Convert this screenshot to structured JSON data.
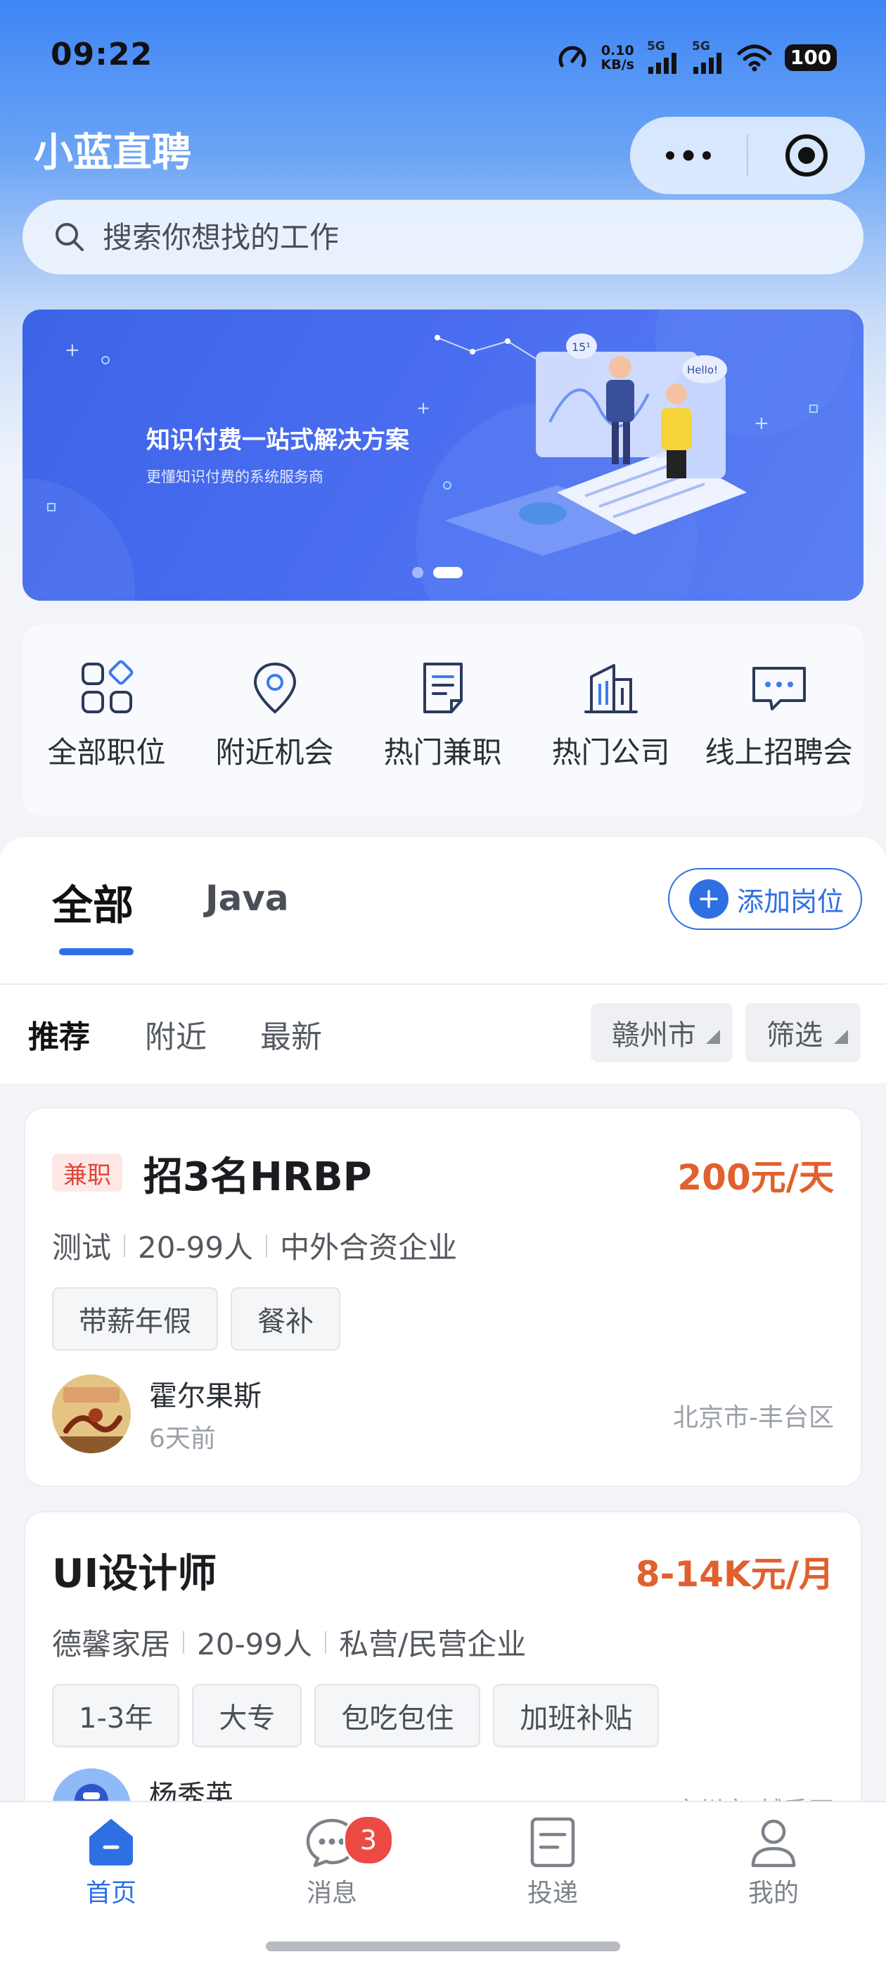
{
  "status_bar": {
    "time": "09:22",
    "net_speed_value": "0.10",
    "net_speed_unit": "KB/s",
    "signal_labels": [
      "5G",
      "5G"
    ],
    "battery": "100"
  },
  "header": {
    "app_title": "小蓝直聘"
  },
  "search": {
    "placeholder": "搜索你想找的工作"
  },
  "banner": {
    "title": "知识付费一站式解决方案",
    "subtitle": "更懂知识付费的系统服务商",
    "bubble_1": "15¹",
    "bubble_2": "Hello!",
    "total_slides": 2,
    "active_slide": 2
  },
  "quick_nav": [
    {
      "label": "全部职位",
      "icon": "grid-icon"
    },
    {
      "label": "附近机会",
      "icon": "location-pin-icon"
    },
    {
      "label": "热门兼职",
      "icon": "document-icon"
    },
    {
      "label": "热门公司",
      "icon": "building-icon"
    },
    {
      "label": "线上招聘会",
      "icon": "chat-bubble-icon"
    }
  ],
  "job_tabs": {
    "tabs": [
      "全部",
      "Java"
    ],
    "active": "全部",
    "add_button": "添加岗位"
  },
  "filters": {
    "sort_options": [
      "推荐",
      "附近",
      "最新"
    ],
    "active_sort": "推荐",
    "city": "赣州市",
    "filter_button": "筛选"
  },
  "jobs": [
    {
      "type_tag": "兼职",
      "title": "招3名HRBP",
      "salary": "200元/天",
      "company": "测试",
      "size": "20-99人",
      "company_type": "中外合资企业",
      "tags": [
        "带薪年假",
        "餐补"
      ],
      "recruiter": "霍尔果斯",
      "posted": "6天前",
      "location": "北京市-丰台区"
    },
    {
      "title": "UI设计师",
      "salary": "8-14K元/月",
      "company": "德馨家居",
      "size": "20-99人",
      "company_type": "私营/民营企业",
      "tags": [
        "1-3年",
        "大专",
        "包吃包住",
        "加班补贴"
      ],
      "recruiter": "杨秀英",
      "location": "广州市-越秀区"
    }
  ],
  "bottom_nav": {
    "items": [
      "首页",
      "消息",
      "投递",
      "我的"
    ],
    "active": "首页",
    "message_badge": "3"
  },
  "colors": {
    "primary": "#2f6fe4",
    "salary": "#e0602e",
    "badge": "#ec4b45"
  }
}
